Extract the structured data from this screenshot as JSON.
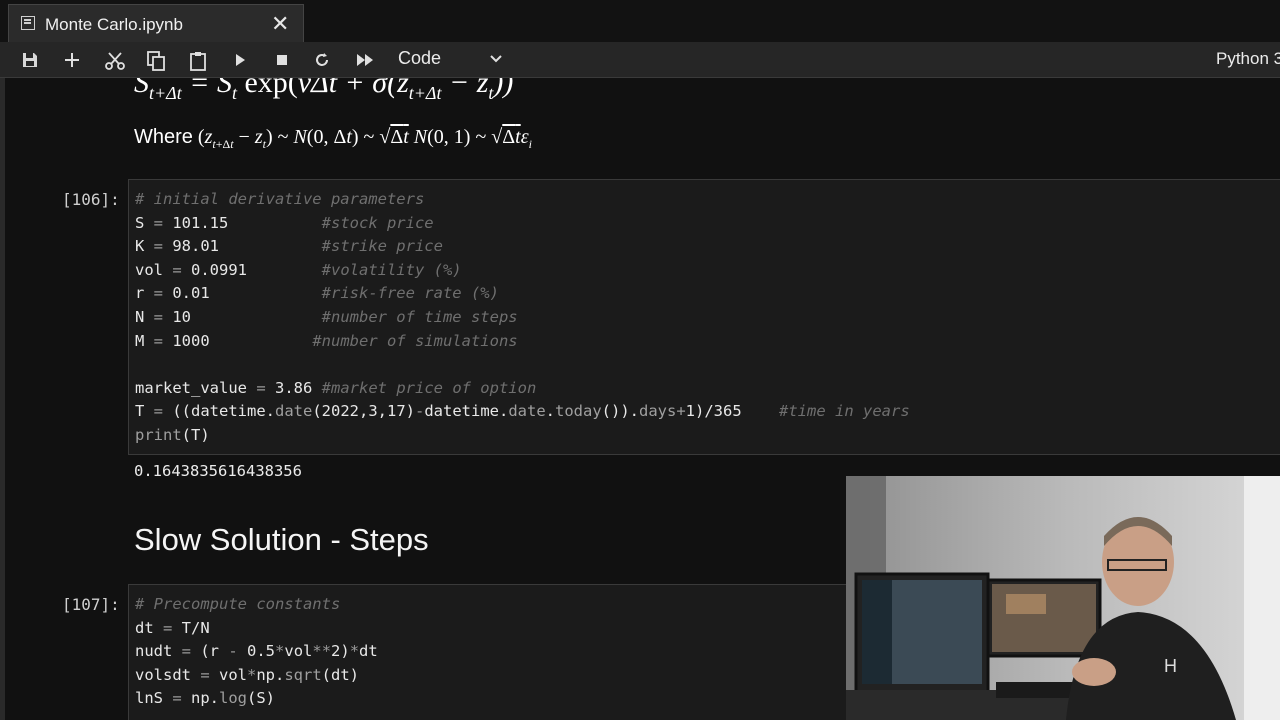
{
  "tab": {
    "title": "Monte Carlo.ipynb",
    "close": "✕"
  },
  "toolbar": {
    "buttons": [
      "save",
      "insert-cell-below",
      "cut",
      "copy",
      "paste",
      "run",
      "interrupt",
      "restart",
      "restart-run-all"
    ],
    "cell_type": "Code",
    "kernel": "Python 3"
  },
  "markdown": {
    "eq1": "S_{t+Δt} = S_t exp(νΔt + σ(z_{t+Δt} − z_t))",
    "eq2": "Where (z_{t+Δt} − z_t) ~ N(0, Δt) ~ √Δt N(0,1) ~ √Δt ε_i"
  },
  "cells": [
    {
      "prompt": "[106]:",
      "lines": [
        "# initial derivative parameters",
        "S = 101.15          #stock price",
        "K = 98.01           #strike price",
        "vol = 0.0991        #volatility (%)",
        "r = 0.01            #risk-free rate (%)",
        "N = 10              #number of time steps",
        "M = 1000           #number of simulations",
        "",
        "market_value = 3.86 #market price of option",
        "T = ((datetime.date(2022,3,17)-datetime.date.today()).days+1)/365    #time in years",
        "print(T)"
      ],
      "output": "0.1643835616438356"
    },
    {
      "prompt": "[107]:",
      "lines": [
        "# Precompute constants",
        "dt = T/N",
        "nudt = (r - 0.5*vol**2)*dt",
        "volsdt = vol*np.sqrt(dt)",
        "lnS = np.log(S)"
      ]
    }
  ],
  "heading": "Slow Solution - Steps",
  "colors": {
    "background": "#111111",
    "cell_bg": "#1b1b1b",
    "comment": "#6f6f6f",
    "text": "#e8e8e8"
  }
}
